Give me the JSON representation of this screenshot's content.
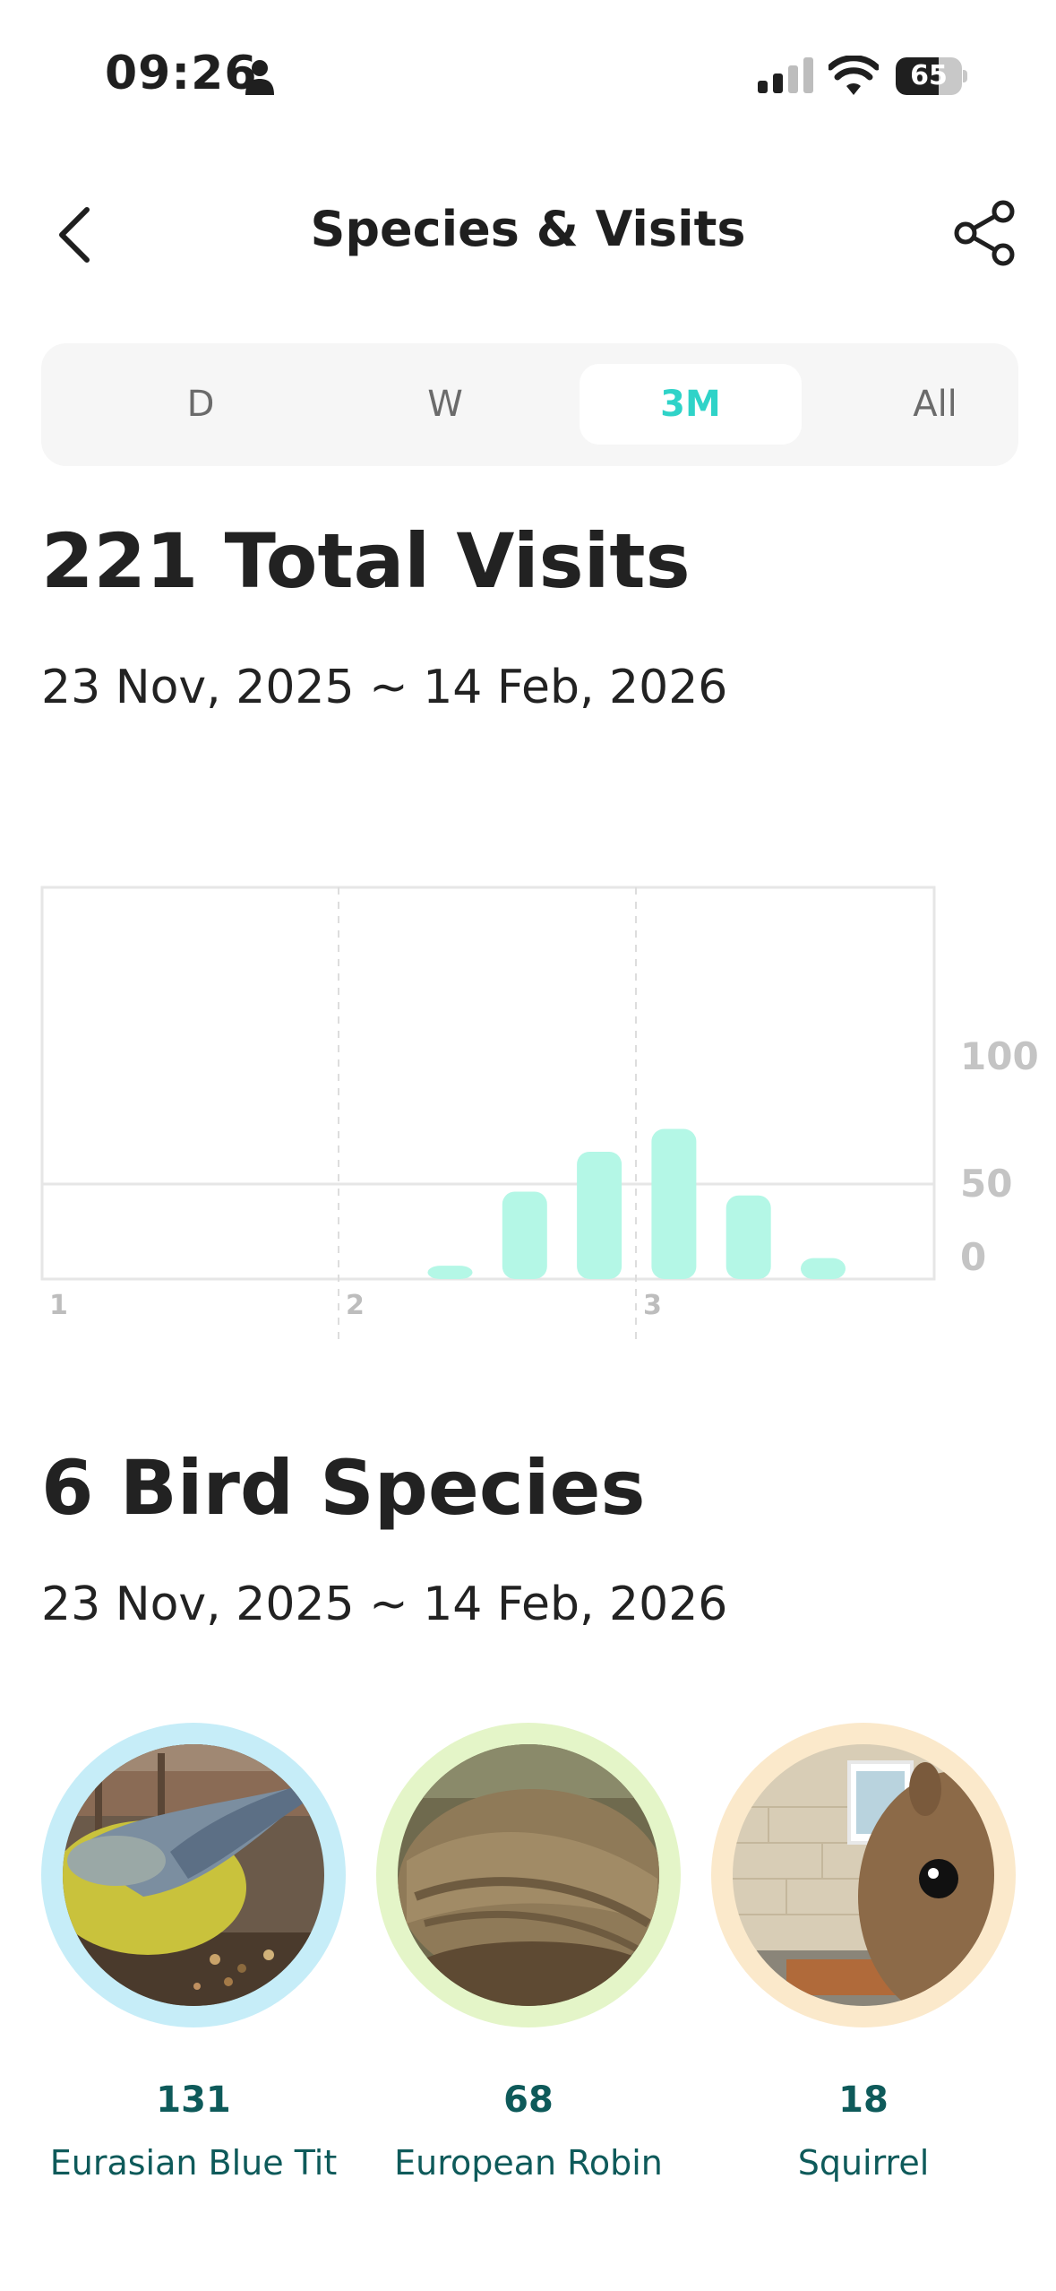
{
  "status_bar": {
    "time": "09:26",
    "battery": "65",
    "battery_level": 0.65
  },
  "nav": {
    "title": "Species & Visits"
  },
  "tabs": [
    {
      "label": "D",
      "active": false
    },
    {
      "label": "W",
      "active": false
    },
    {
      "label": "3M",
      "active": true
    },
    {
      "label": "All",
      "active": false
    }
  ],
  "visits": {
    "title": "221 Total Visits",
    "date_range": "23 Nov, 2025 ~ 14 Feb, 2026"
  },
  "chart_data": {
    "type": "bar",
    "x_ticks": [
      "1",
      "2",
      "3"
    ],
    "y_ticks": [
      "100",
      "50",
      "0"
    ],
    "ylim": [
      0,
      100
    ],
    "bar_color": "#b4f7e6",
    "values": [
      0,
      0,
      0,
      0,
      0,
      7,
      46,
      67,
      79,
      44,
      11
    ],
    "grid": true
  },
  "species": {
    "title": "6 Bird Species",
    "date_range": "23 Nov, 2025 ~ 14 Feb, 2026",
    "items": [
      {
        "count": "131",
        "name": "Eurasian Blue Tit",
        "ring_color": "#c6edf8"
      },
      {
        "count": "68",
        "name": "European Robin",
        "ring_color": "#e4f5c8"
      },
      {
        "count": "18",
        "name": "Squirrel",
        "ring_color": "#fbe9cb"
      }
    ]
  }
}
